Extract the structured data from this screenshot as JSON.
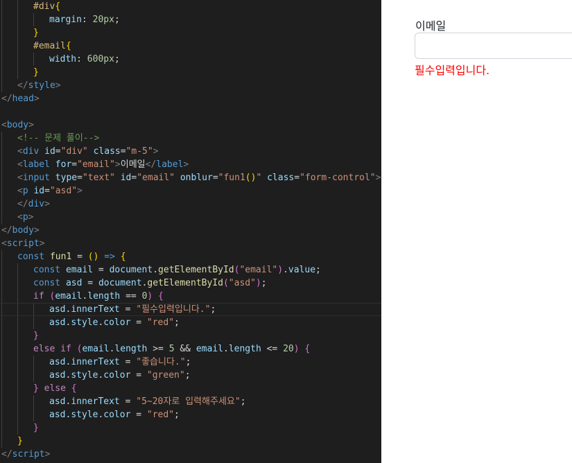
{
  "editor": {
    "lines": [
      {
        "indent": 2,
        "tokens": [
          [
            "sel",
            "#div"
          ],
          [
            "p1",
            "{"
          ]
        ]
      },
      {
        "indent": 3,
        "tokens": [
          [
            "prop",
            "margin"
          ],
          [
            "plain",
            ": "
          ],
          [
            "num",
            "20px"
          ],
          [
            "plain",
            ";"
          ]
        ]
      },
      {
        "indent": 2,
        "tokens": [
          [
            "p1",
            "}"
          ]
        ]
      },
      {
        "indent": 2,
        "tokens": [
          [
            "sel",
            "#email"
          ],
          [
            "p1",
            "{"
          ]
        ]
      },
      {
        "indent": 3,
        "tokens": [
          [
            "prop",
            "width"
          ],
          [
            "plain",
            ": "
          ],
          [
            "num",
            "600px"
          ],
          [
            "plain",
            ";"
          ]
        ]
      },
      {
        "indent": 2,
        "tokens": [
          [
            "p1",
            "}"
          ]
        ]
      },
      {
        "indent": 1,
        "tokens": [
          [
            "br",
            "</"
          ],
          [
            "tag",
            "style"
          ],
          [
            "br",
            ">"
          ]
        ]
      },
      {
        "indent": 0,
        "tokens": [
          [
            "br",
            "</"
          ],
          [
            "tag",
            "head"
          ],
          [
            "br",
            ">"
          ]
        ]
      },
      {
        "indent": 0,
        "tokens": []
      },
      {
        "indent": 0,
        "tokens": [
          [
            "br",
            "<"
          ],
          [
            "tag",
            "body"
          ],
          [
            "br",
            ">"
          ]
        ]
      },
      {
        "indent": 1,
        "tokens": [
          [
            "cmt",
            "<!-- 문제 풀이-->"
          ]
        ]
      },
      {
        "indent": 1,
        "tokens": [
          [
            "br",
            "<"
          ],
          [
            "tag",
            "div"
          ],
          [
            "plain",
            " "
          ],
          [
            "attr",
            "id"
          ],
          [
            "plain",
            "="
          ],
          [
            "str",
            "\"div\""
          ],
          [
            "plain",
            " "
          ],
          [
            "attr",
            "class"
          ],
          [
            "plain",
            "="
          ],
          [
            "str",
            "\"m-5\""
          ],
          [
            "br",
            ">"
          ]
        ]
      },
      {
        "indent": 1,
        "tokens": [
          [
            "br",
            "<"
          ],
          [
            "tag",
            "label"
          ],
          [
            "plain",
            " "
          ],
          [
            "attr",
            "for"
          ],
          [
            "plain",
            "="
          ],
          [
            "str",
            "\"email\""
          ],
          [
            "br",
            ">"
          ],
          [
            "plain",
            "이메일"
          ],
          [
            "br",
            "</"
          ],
          [
            "tag",
            "label"
          ],
          [
            "br",
            ">"
          ]
        ]
      },
      {
        "indent": 1,
        "tokens": [
          [
            "br",
            "<"
          ],
          [
            "tag",
            "input"
          ],
          [
            "plain",
            " "
          ],
          [
            "attr",
            "type"
          ],
          [
            "plain",
            "="
          ],
          [
            "str",
            "\"text\""
          ],
          [
            "plain",
            " "
          ],
          [
            "attr",
            "id"
          ],
          [
            "plain",
            "="
          ],
          [
            "str",
            "\"email\""
          ],
          [
            "plain",
            " "
          ],
          [
            "attr",
            "onblur"
          ],
          [
            "plain",
            "="
          ],
          [
            "str",
            "\"fun1"
          ],
          [
            "p1",
            "()"
          ],
          [
            "str",
            "\""
          ],
          [
            "plain",
            " "
          ],
          [
            "attr",
            "class"
          ],
          [
            "plain",
            "="
          ],
          [
            "str",
            "\"form-control\""
          ],
          [
            "br",
            ">"
          ]
        ]
      },
      {
        "indent": 1,
        "tokens": [
          [
            "br",
            "<"
          ],
          [
            "tag",
            "p"
          ],
          [
            "plain",
            " "
          ],
          [
            "attr",
            "id"
          ],
          [
            "plain",
            "="
          ],
          [
            "str",
            "\"asd\""
          ],
          [
            "br",
            ">"
          ]
        ]
      },
      {
        "indent": 1,
        "tokens": [
          [
            "br",
            "</"
          ],
          [
            "tag",
            "div"
          ],
          [
            "br",
            ">"
          ]
        ]
      },
      {
        "indent": 1,
        "tokens": [
          [
            "br",
            "<"
          ],
          [
            "tag",
            "p"
          ],
          [
            "br",
            ">"
          ]
        ]
      },
      {
        "indent": 0,
        "tokens": [
          [
            "br",
            "</"
          ],
          [
            "tag",
            "body"
          ],
          [
            "br",
            ">"
          ]
        ]
      },
      {
        "indent": 0,
        "tokens": [
          [
            "br",
            "<"
          ],
          [
            "tag",
            "script"
          ],
          [
            "br",
            ">"
          ]
        ]
      },
      {
        "indent": 1,
        "tokens": [
          [
            "kw",
            "const"
          ],
          [
            "plain",
            " "
          ],
          [
            "fn",
            "fun1"
          ],
          [
            "plain",
            " = "
          ],
          [
            "p1",
            "()"
          ],
          [
            "plain",
            " "
          ],
          [
            "kw",
            "=>"
          ],
          [
            "plain",
            " "
          ],
          [
            "p1",
            "{"
          ]
        ]
      },
      {
        "indent": 2,
        "tokens": [
          [
            "kw",
            "const"
          ],
          [
            "plain",
            " "
          ],
          [
            "var",
            "email"
          ],
          [
            "plain",
            " = "
          ],
          [
            "var",
            "document"
          ],
          [
            "plain",
            "."
          ],
          [
            "fn",
            "getElementById"
          ],
          [
            "p2",
            "("
          ],
          [
            "str",
            "\"email\""
          ],
          [
            "p2",
            ")"
          ],
          [
            "plain",
            "."
          ],
          [
            "var",
            "value"
          ],
          [
            "plain",
            ";"
          ]
        ]
      },
      {
        "indent": 2,
        "tokens": [
          [
            "kw",
            "const"
          ],
          [
            "plain",
            " "
          ],
          [
            "var",
            "asd"
          ],
          [
            "plain",
            " = "
          ],
          [
            "var",
            "document"
          ],
          [
            "plain",
            "."
          ],
          [
            "fn",
            "getElementById"
          ],
          [
            "p2",
            "("
          ],
          [
            "str",
            "\"asd\""
          ],
          [
            "p2",
            ")"
          ],
          [
            "plain",
            ";"
          ]
        ]
      },
      {
        "indent": 2,
        "tokens": [
          [
            "ctl",
            "if"
          ],
          [
            "plain",
            " "
          ],
          [
            "p2",
            "("
          ],
          [
            "var",
            "email"
          ],
          [
            "plain",
            "."
          ],
          [
            "var",
            "length"
          ],
          [
            "plain",
            " == "
          ],
          [
            "num",
            "0"
          ],
          [
            "p2",
            ")"
          ],
          [
            "plain",
            " "
          ],
          [
            "p2",
            "{"
          ]
        ]
      },
      {
        "indent": 3,
        "current": true,
        "tokens": [
          [
            "var",
            "asd"
          ],
          [
            "plain",
            "."
          ],
          [
            "var",
            "innerText"
          ],
          [
            "plain",
            " = "
          ],
          [
            "str",
            "\"필수입력입니다.\""
          ],
          [
            "plain",
            ";"
          ]
        ]
      },
      {
        "indent": 3,
        "tokens": [
          [
            "var",
            "asd"
          ],
          [
            "plain",
            "."
          ],
          [
            "var",
            "style"
          ],
          [
            "plain",
            "."
          ],
          [
            "var",
            "color"
          ],
          [
            "plain",
            " = "
          ],
          [
            "str",
            "\"red\""
          ],
          [
            "plain",
            ";"
          ]
        ]
      },
      {
        "indent": 2,
        "tokens": [
          [
            "p2",
            "}"
          ]
        ]
      },
      {
        "indent": 2,
        "tokens": [
          [
            "ctl",
            "else"
          ],
          [
            "plain",
            " "
          ],
          [
            "ctl",
            "if"
          ],
          [
            "plain",
            " "
          ],
          [
            "p2",
            "("
          ],
          [
            "var",
            "email"
          ],
          [
            "plain",
            "."
          ],
          [
            "var",
            "length"
          ],
          [
            "plain",
            " >= "
          ],
          [
            "num",
            "5"
          ],
          [
            "plain",
            " && "
          ],
          [
            "var",
            "email"
          ],
          [
            "plain",
            "."
          ],
          [
            "var",
            "length"
          ],
          [
            "plain",
            " <= "
          ],
          [
            "num",
            "20"
          ],
          [
            "p2",
            ")"
          ],
          [
            "plain",
            " "
          ],
          [
            "p2",
            "{"
          ]
        ]
      },
      {
        "indent": 3,
        "tokens": [
          [
            "var",
            "asd"
          ],
          [
            "plain",
            "."
          ],
          [
            "var",
            "innerText"
          ],
          [
            "plain",
            " = "
          ],
          [
            "str",
            "\"좋습니다.\""
          ],
          [
            "plain",
            ";"
          ]
        ]
      },
      {
        "indent": 3,
        "tokens": [
          [
            "var",
            "asd"
          ],
          [
            "plain",
            "."
          ],
          [
            "var",
            "style"
          ],
          [
            "plain",
            "."
          ],
          [
            "var",
            "color"
          ],
          [
            "plain",
            " = "
          ],
          [
            "str",
            "\"green\""
          ],
          [
            "plain",
            ";"
          ]
        ]
      },
      {
        "indent": 2,
        "tokens": [
          [
            "p2",
            "}"
          ],
          [
            "plain",
            " "
          ],
          [
            "ctl",
            "else"
          ],
          [
            "plain",
            " "
          ],
          [
            "p2",
            "{"
          ]
        ]
      },
      {
        "indent": 3,
        "tokens": [
          [
            "var",
            "asd"
          ],
          [
            "plain",
            "."
          ],
          [
            "var",
            "innerText"
          ],
          [
            "plain",
            " = "
          ],
          [
            "str",
            "\"5~20자로 입력해주세요\""
          ],
          [
            "plain",
            ";"
          ]
        ]
      },
      {
        "indent": 3,
        "tokens": [
          [
            "var",
            "asd"
          ],
          [
            "plain",
            "."
          ],
          [
            "var",
            "style"
          ],
          [
            "plain",
            "."
          ],
          [
            "var",
            "color"
          ],
          [
            "plain",
            " = "
          ],
          [
            "str",
            "\"red\""
          ],
          [
            "plain",
            ";"
          ]
        ]
      },
      {
        "indent": 2,
        "tokens": [
          [
            "p2",
            "}"
          ]
        ]
      },
      {
        "indent": 1,
        "tokens": [
          [
            "p1",
            "}"
          ]
        ]
      },
      {
        "indent": 0,
        "tokens": [
          [
            "br",
            "</"
          ],
          [
            "tag",
            "script"
          ],
          [
            "br",
            ">"
          ]
        ]
      }
    ]
  },
  "preview": {
    "label": "이메일",
    "input_value": "",
    "message": "필수입력입니다.",
    "message_color": "#ff0000"
  }
}
